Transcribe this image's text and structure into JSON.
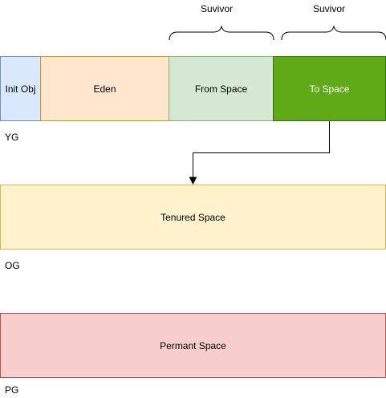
{
  "blocks": {
    "init_obj": "Init Obj",
    "eden": "Eden",
    "from_space": "From Space",
    "to_space": "To Space",
    "tenured": "Tenured Space",
    "permant": "Permant Space"
  },
  "survivor_labels": [
    "Suvivor",
    "Suvivor"
  ],
  "generation_labels": {
    "young": "YG",
    "old": "OG",
    "permanent": "PG"
  },
  "colors": {
    "init_obj_fill": "#dae8fc",
    "eden_fill": "#ffe6cc",
    "from_space_fill": "#d5e8d4",
    "to_space_fill": "#60a917",
    "tenured_fill": "#fff2cc",
    "permant_fill": "#f8cecc"
  }
}
